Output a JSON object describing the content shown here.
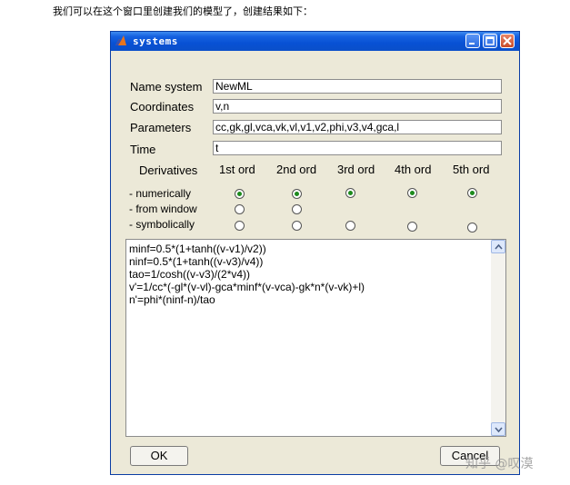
{
  "page": {
    "caption": "我们可以在这个窗口里创建我们的模型了，创建结果如下：",
    "watermark": "知乎 @叹漠"
  },
  "window": {
    "title": "systems",
    "icon": "matlab-logo-icon",
    "controls": [
      "minimize-icon",
      "maximize-icon",
      "close-icon"
    ]
  },
  "form": {
    "name_label": "Name system",
    "name_value": "NewML",
    "coords_label": "Coordinates",
    "coords_value": "v,n",
    "params_label": "Parameters",
    "params_value": "cc,gk,gl,vca,vk,vl,v1,v2,phi,v3,v4,gca,l",
    "time_label": "Time",
    "time_value": "t"
  },
  "derivatives": {
    "label": "Derivatives",
    "columns": [
      "1st ord",
      "2nd ord",
      "3rd ord",
      "4th ord",
      "5th ord"
    ],
    "rows": [
      {
        "label": "- numerically",
        "radios": [
          true,
          true,
          true,
          true,
          true
        ]
      },
      {
        "label": "- from window",
        "radios": [
          false,
          false
        ]
      },
      {
        "label": "- symbolically",
        "radios": [
          false,
          false,
          false,
          false,
          false
        ]
      }
    ]
  },
  "equations": {
    "text": "minf=0.5*(1+tanh((v-v1)/v2))\nninf=0.5*(1+tanh((v-v3)/v4))\ntao=1/cosh((v-v3)/(2*v4))\nv'=1/cc*(-gl*(v-vl)-gca*minf*(v-vca)-gk*n*(v-vk)+l)\nn'=phi*(ninf-n)/tao"
  },
  "buttons": {
    "ok": "OK",
    "cancel": "Cancel"
  },
  "colors": {
    "titlebar": "#0a51d2",
    "dialog": "#ece9d8",
    "radio_selected": "#1c8a1c"
  }
}
